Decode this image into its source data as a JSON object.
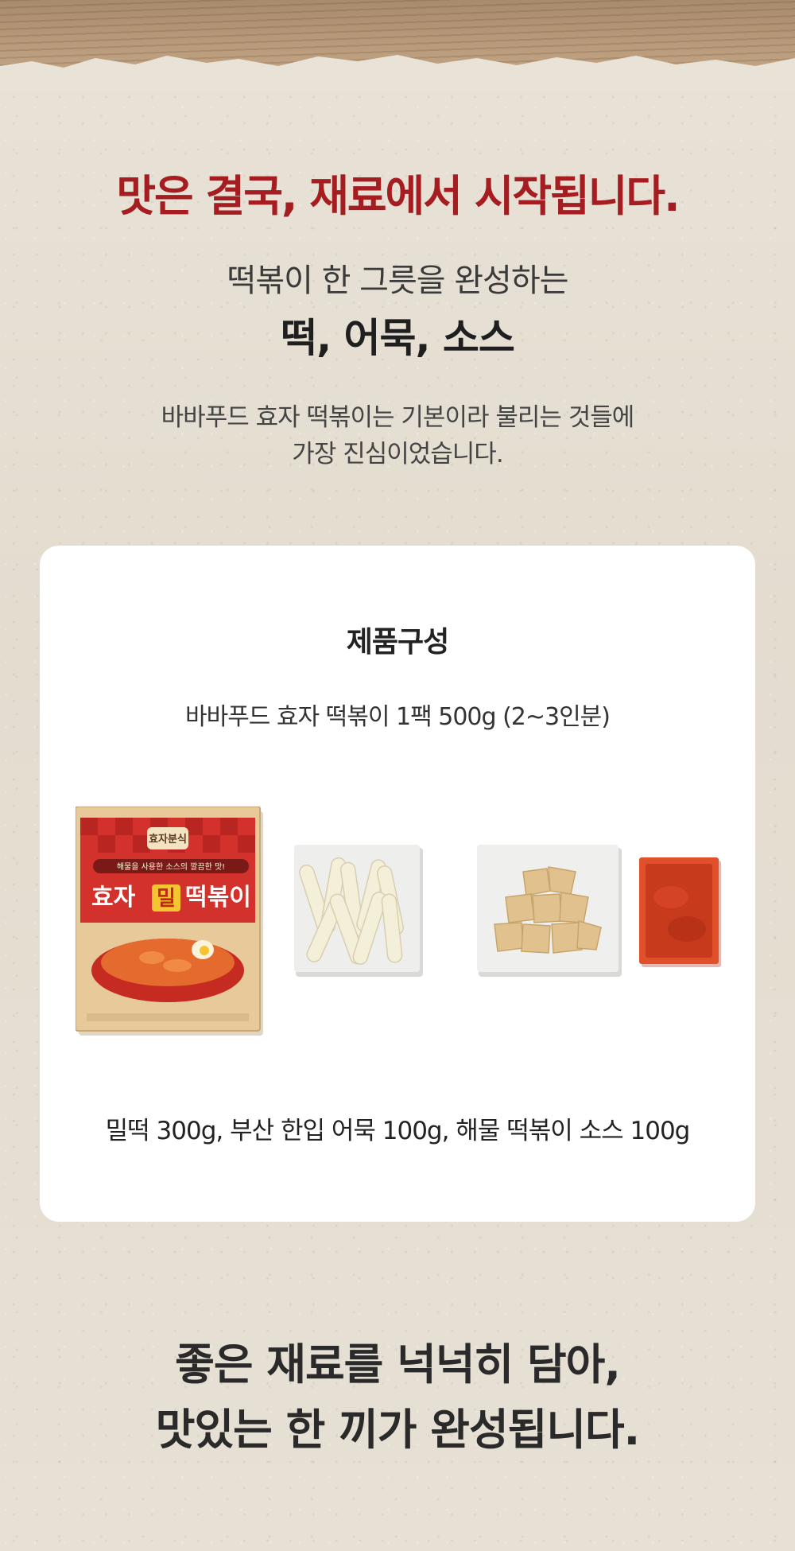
{
  "headline": "맛은 결국, 재료에서 시작됩니다.",
  "intro": {
    "line1": "떡볶이 한 그릇을 완성하는",
    "line2": "떡, 어묵, 소스"
  },
  "description": {
    "line1": "바바푸드 효자 떡볶이는 기본이라 불리는 것들에",
    "line2": "가장 진심이었습니다."
  },
  "composition": {
    "title": "제품구성",
    "subtitle": "바바푸드 효자 떡볶이 1팩 500g (2~3인분)",
    "items_caption": "밀떡 300g, 부산 한입 어묵 100g, 해물 떡볶이 소스 100g",
    "package": {
      "brand": "효자분식",
      "tagline": "해물을 사용한 소스의 깔끔한 맛!",
      "name_part1": "효자",
      "name_highlight": "밀",
      "name_part2": "떡볶이"
    }
  },
  "closing": {
    "line1": "좋은 재료를 넉넉히 담아,",
    "line2": "맛있는 한 끼가 완성됩니다."
  },
  "colors": {
    "accent_red": "#a51d21",
    "package_red": "#d3312c",
    "sauce_orange": "#e0502a"
  }
}
